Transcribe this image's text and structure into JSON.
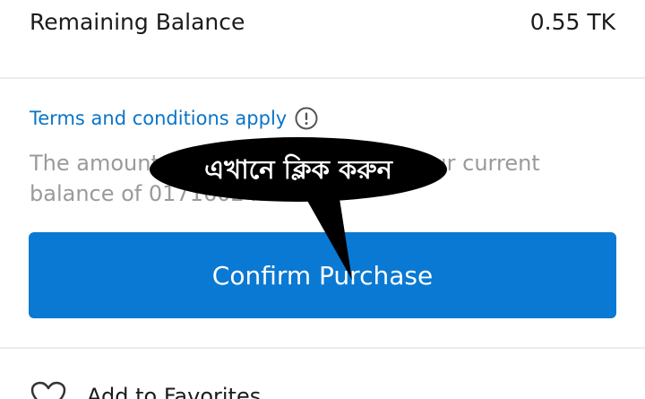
{
  "balance": {
    "label": "Remaining Balance",
    "value": "0.55 TK"
  },
  "terms": {
    "link_text": "Terms and conditions apply",
    "info_icon": "info-circle-icon"
  },
  "description": {
    "text": "The amount will be deducted from your current balance of 01716024..."
  },
  "confirm": {
    "label": "Confirm Purchase",
    "color": "#0a79d3"
  },
  "favorites": {
    "label": "Add to Favorites",
    "icon": "heart-icon"
  },
  "callout": {
    "text": "এখানে ক্লিক করুন",
    "color": "#000000"
  },
  "colors": {
    "link": "#0a74c8",
    "muted_text": "#9a9a9a",
    "primary_text": "#1b1b1b"
  }
}
